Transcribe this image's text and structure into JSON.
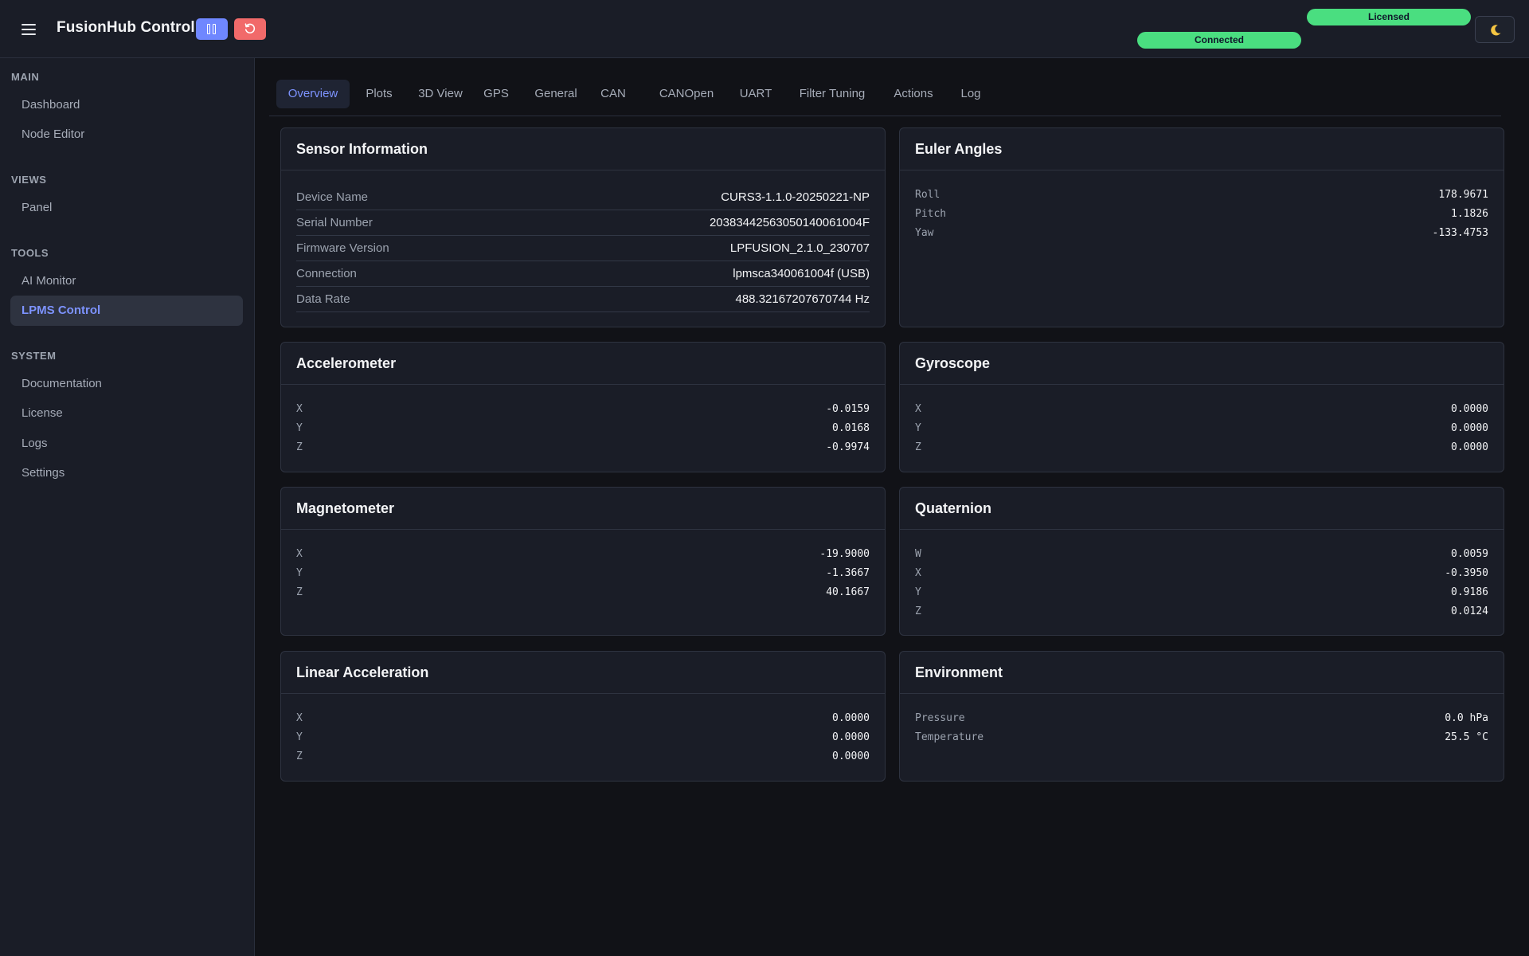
{
  "header": {
    "app_title": "FusionHub Control",
    "pause_icon": "pause-icon",
    "reset_icon": "refresh-icon",
    "licensed_label": "Licensed",
    "connected_label": "Connected",
    "theme_icon": "moon-icon",
    "status_color": "#4ade80",
    "pause_color": "#6f87ff",
    "reset_color": "#f16a6a"
  },
  "sidebar": {
    "sections": [
      {
        "title": "MAIN",
        "items": [
          {
            "label": "Dashboard"
          },
          {
            "label": "Node Editor"
          }
        ]
      },
      {
        "title": "VIEWS",
        "items": [
          {
            "label": "Panel"
          }
        ]
      },
      {
        "title": "TOOLS",
        "items": [
          {
            "label": "AI Monitor"
          },
          {
            "label": "LPMS Control",
            "active": true
          }
        ]
      },
      {
        "title": "SYSTEM",
        "items": [
          {
            "label": "Documentation"
          },
          {
            "label": "License"
          },
          {
            "label": "Logs"
          },
          {
            "label": "Settings"
          }
        ]
      }
    ]
  },
  "tabs": [
    {
      "label": "Overview",
      "active": true
    },
    {
      "label": "Plots"
    },
    {
      "label": "3D View"
    },
    {
      "label": "GPS"
    },
    {
      "label": "General"
    },
    {
      "label": "CAN"
    },
    {
      "label": "CANOpen"
    },
    {
      "label": "UART"
    },
    {
      "label": "Filter Tuning"
    },
    {
      "label": "Actions"
    },
    {
      "label": "Log"
    }
  ],
  "cards": {
    "sensor_info": {
      "title": "Sensor Information",
      "rows": [
        {
          "label": "Device Name",
          "value": "CURS3-1.1.0-20250221-NP"
        },
        {
          "label": "Serial Number",
          "value": "20383442563050140061004F"
        },
        {
          "label": "Firmware Version",
          "value": "LPFUSION_2.1.0_230707"
        },
        {
          "label": "Connection",
          "value": "lpmsca340061004f (USB)"
        },
        {
          "label": "Data Rate",
          "value": "488.32167207670744 Hz"
        }
      ]
    },
    "euler": {
      "title": "Euler Angles",
      "rows": [
        {
          "label": "Roll",
          "value": "178.9671"
        },
        {
          "label": "Pitch",
          "value": "1.1826"
        },
        {
          "label": "Yaw",
          "value": "-133.4753"
        }
      ]
    },
    "accel": {
      "title": "Accelerometer",
      "rows": [
        {
          "label": "X",
          "value": "-0.0159"
        },
        {
          "label": "Y",
          "value": "0.0168"
        },
        {
          "label": "Z",
          "value": "-0.9974"
        }
      ]
    },
    "gyro": {
      "title": "Gyroscope",
      "rows": [
        {
          "label": "X",
          "value": "0.0000"
        },
        {
          "label": "Y",
          "value": "0.0000"
        },
        {
          "label": "Z",
          "value": "0.0000"
        }
      ]
    },
    "mag": {
      "title": "Magnetometer",
      "rows": [
        {
          "label": "X",
          "value": "-19.9000"
        },
        {
          "label": "Y",
          "value": "-1.3667"
        },
        {
          "label": "Z",
          "value": "40.1667"
        }
      ]
    },
    "quat": {
      "title": "Quaternion",
      "rows": [
        {
          "label": "W",
          "value": "0.0059"
        },
        {
          "label": "X",
          "value": "-0.3950"
        },
        {
          "label": "Y",
          "value": "0.9186"
        },
        {
          "label": "Z",
          "value": "0.0124"
        }
      ]
    },
    "linacc": {
      "title": "Linear Acceleration",
      "rows": [
        {
          "label": "X",
          "value": "0.0000"
        },
        {
          "label": "Y",
          "value": "0.0000"
        },
        {
          "label": "Z",
          "value": "0.0000"
        }
      ]
    },
    "env": {
      "title": "Environment",
      "rows": [
        {
          "label": "Pressure",
          "value": "0.0 hPa"
        },
        {
          "label": "Temperature",
          "value": "25.5 °C"
        }
      ]
    }
  }
}
